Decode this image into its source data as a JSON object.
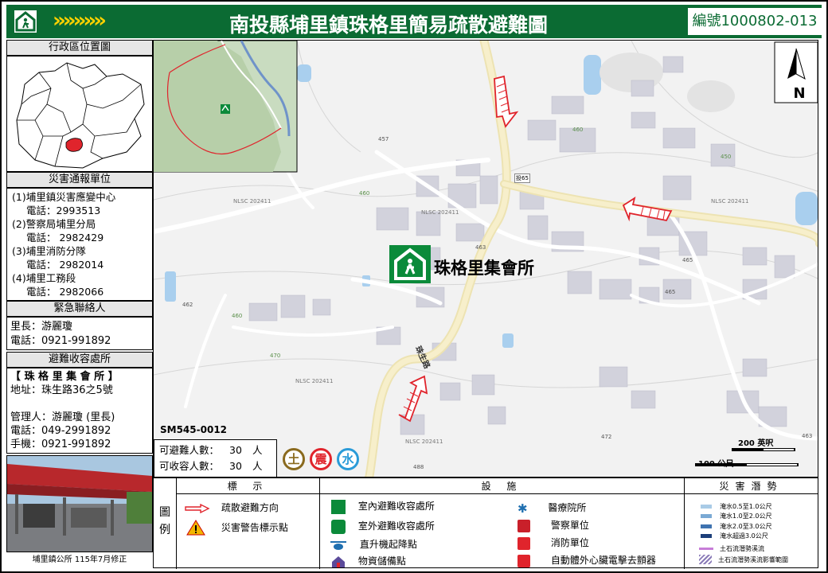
{
  "header": {
    "title": "南投縣埔里鎮珠格里簡易疏散避難圖",
    "code": "編號1000802-013",
    "arrows": "»»»»»"
  },
  "admin_map": {
    "label": "行政區位置圖"
  },
  "report_units": {
    "label": "災害通報單位",
    "items": [
      {
        "name": "(1)埔里鎮災害應變中心",
        "phone": "電話：2993513"
      },
      {
        "name": "(2)警察局埔里分局",
        "phone": "電話： 2982429"
      },
      {
        "name": "(3)埔里消防分隊",
        "phone": "電話： 2982014"
      },
      {
        "name": "(4)埔里工務段",
        "phone": "電話： 2982066"
      }
    ]
  },
  "contact": {
    "label": "緊急聯絡人",
    "lines": [
      "里長：游麗瓊",
      "電話：0921-991892"
    ]
  },
  "shelter_info": {
    "label": "避難收容處所",
    "name": "【 珠 格 里 集 會 所 】",
    "address": "地址：珠生路36之5號",
    "lines": [
      "管理人：游麗瓊 (里長)",
      "電話：049-2991892",
      "手機：0921-991892"
    ]
  },
  "photo_caption": "埔里鎮公所 115年7月修正",
  "map": {
    "sheet_id": "SM545-0012",
    "shelter_label": "珠格里集會所",
    "north": "N",
    "road_label": "珠生路",
    "road_code": "投65",
    "scale_top": "200 英呎",
    "scale_bottom": "100 公尺",
    "capacity": [
      "可避難人數：",
      "30",
      "人",
      "可收容人數：",
      "30",
      "人"
    ],
    "hazard_badges": [
      "土",
      "震",
      "水"
    ],
    "land_labels": [
      "NLSC 202411",
      "NLSC 202411",
      "NLSC 202411",
      "NLSC 202411",
      "NLSC 202411"
    ],
    "elevations": [
      "457",
      "460",
      "460",
      "463",
      "465",
      "465",
      "462",
      "460",
      "470",
      "472",
      "463",
      "488",
      "450"
    ]
  },
  "legend": {
    "side_label": [
      "圖",
      "例"
    ],
    "symbols_head": "標 示",
    "facilities_head": "設 施",
    "hazards_head": "災害潛勢",
    "symbols": [
      "疏散避難方向",
      "災害警告標示點"
    ],
    "facilities_a": [
      "室內避難收容處所",
      "室外避難收容處所",
      "直升機起降點",
      "物資儲備點"
    ],
    "facilities_b": [
      "醫療院所",
      "警察單位",
      "消防單位",
      "自動體外心臟電擊去顫器"
    ],
    "hazards": [
      "淹水0.5至1.0公尺",
      "淹水1.0至2.0公尺",
      "淹水2.0至3.0公尺",
      "淹水超過3.0公尺",
      "土石流潛勢溪流",
      "土石流潛勢溪流影響範圍"
    ]
  },
  "colors": {
    "header_green": "#0b6b33",
    "accent_yellow": "#ffd200",
    "evac_red": "#e0242c",
    "flood": [
      "#a9cbe6",
      "#7aa9d4",
      "#3f73b0",
      "#1c3f7a"
    ],
    "debris": "#c77dd8"
  }
}
